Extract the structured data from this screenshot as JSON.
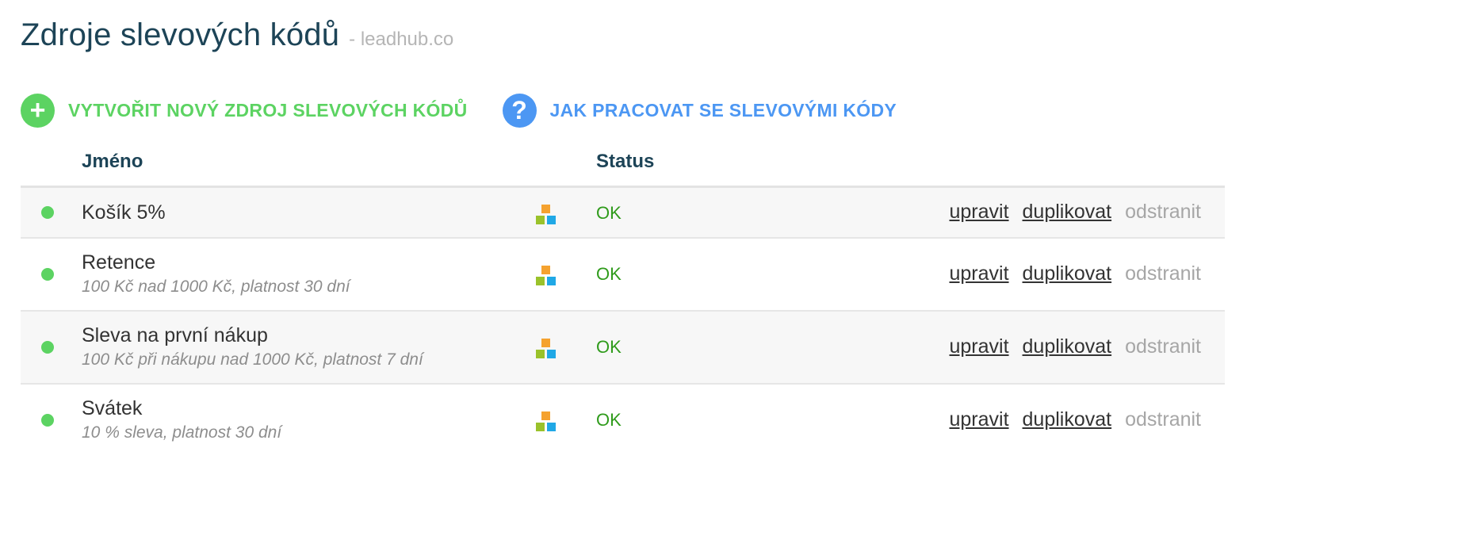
{
  "header": {
    "title": "Zdroje slevových kódů",
    "site": "- leadhub.co"
  },
  "actions": {
    "create_label": "VYTVOŘIT NOVÝ ZDROJ SLEVOVÝCH KÓDŮ",
    "create_icon": "plus-icon",
    "create_glyph": "+",
    "help_label": "JAK PRACOVAT SE SLEVOVÝMI KÓDY",
    "help_icon": "question-icon",
    "help_glyph": "?"
  },
  "table": {
    "columns": {
      "name": "Jméno",
      "status": "Status"
    },
    "rows": [
      {
        "name": "Košík 5%",
        "description": "",
        "status": "OK",
        "edit": "upravit",
        "duplicate": "duplikovat",
        "remove": "odstranit"
      },
      {
        "name": "Retence",
        "description": "100 Kč nad 1000 Kč, platnost 30 dní",
        "status": "OK",
        "edit": "upravit",
        "duplicate": "duplikovat",
        "remove": "odstranit"
      },
      {
        "name": "Sleva na první nákup",
        "description": "100 Kč při nákupu nad 1000 Kč, platnost 7 dní",
        "status": "OK",
        "edit": "upravit",
        "duplicate": "duplikovat",
        "remove": "odstranit"
      },
      {
        "name": "Svátek",
        "description": "10 % sleva, platnost 30 dní",
        "status": "OK",
        "edit": "upravit",
        "duplicate": "duplikovat",
        "remove": "odstranit"
      }
    ]
  },
  "colors": {
    "title": "#1d4457",
    "create_accent": "#5cd362",
    "help_accent": "#4c97f3",
    "status_ok": "#2f9b1b",
    "status_dot": "#5cd362"
  },
  "icons": {
    "row_status": "green-dot-icon",
    "row_source": "leadhub-blocks-icon"
  }
}
